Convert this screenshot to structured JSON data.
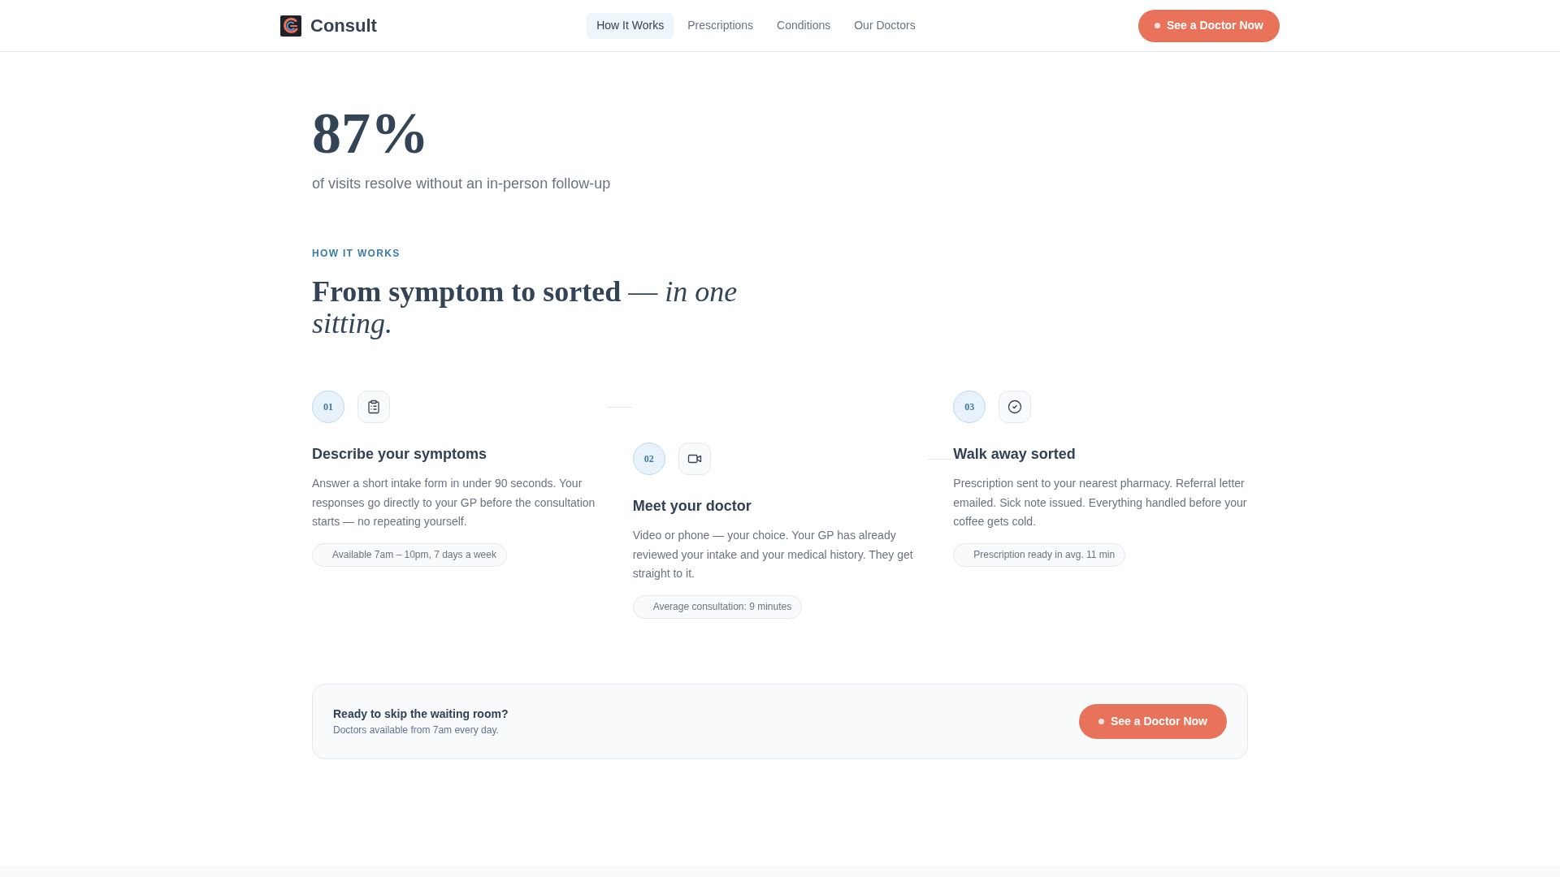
{
  "header": {
    "brand": "Consult",
    "nav": [
      {
        "label": "How It Works",
        "selected": true
      },
      {
        "label": "Prescriptions",
        "selected": false
      },
      {
        "label": "Conditions",
        "selected": false
      },
      {
        "label": "Our Doctors",
        "selected": false
      }
    ],
    "cta": "See a Doctor Now"
  },
  "stat": {
    "value": "87%",
    "caption": "of visits resolve without an in-person follow-up"
  },
  "how_it_works": {
    "eyebrow": "HOW IT WORKS",
    "heading": "**From symptom to sorted** — *in one sitting.*",
    "steps": [
      {
        "number": "01",
        "title": "Describe your symptoms",
        "description": "Answer a short intake form in under 90 seconds. Your responses go directly to your GP before the consultation starts — no repeating yourself.",
        "tag": "Available 7am – 10pm, 7 days a week"
      },
      {
        "number": "02",
        "title": "Meet your doctor",
        "description": "Video or phone — your choice. Your GP has already reviewed your intake and your medical history. They get straight to it.",
        "tag": "Average consultation: 9 minutes"
      },
      {
        "number": "03",
        "title": "Walk away sorted",
        "description": "Prescription sent to your nearest pharmacy. Referral letter emailed. Sick note issued. Everything handled before your coffee gets cold.",
        "tag": "Prescription ready in avg. 11 min"
      }
    ]
  },
  "cta_card": {
    "title": "Ready to skip the waiting room?",
    "subtitle": "Doctors available from 7am every day.",
    "button": "See a Doctor Now"
  }
}
